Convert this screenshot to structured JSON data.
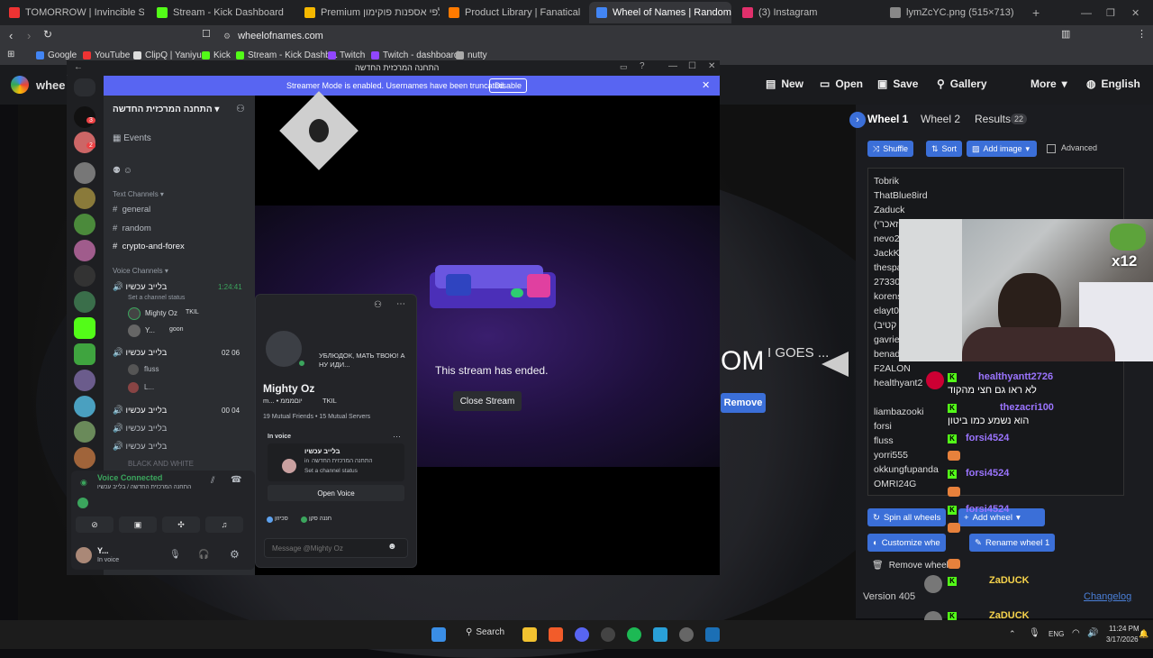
{
  "browser": {
    "tabs": [
      {
        "label": "TOMORROW | Invincible Season 4 O",
        "color": "#e33"
      },
      {
        "label": "Stream - Kick Dashboard",
        "color": "#53fc18"
      },
      {
        "label": "Premium מארז קלפי אספנות פוקימון",
        "color": "#f5b800"
      },
      {
        "label": "Product Library | Fanatical",
        "color": "#ff7a00"
      },
      {
        "label": "Wheel of Names | Random nam",
        "color": "#4285f4"
      },
      {
        "label": "(3) Instagram",
        "color": "#e1306c"
      },
      {
        "label": "lymZcYC.png (515×713)",
        "color": "#888"
      }
    ],
    "url": "wheelofnames.com",
    "bookmarks": [
      "Google",
      "YouTube",
      "ClipQ | Yaniyu",
      "Kick",
      "Stream - Kick Dashb...",
      "Twitch",
      "Twitch - dashboard",
      "nutty"
    ]
  },
  "won": {
    "logo": "whee",
    "menu": [
      "New",
      "Open",
      "Save",
      "Gallery",
      "More",
      "English"
    ],
    "tabs": [
      "Wheel 1",
      "Wheel 2",
      "Results"
    ],
    "results_count": "22",
    "buttons": {
      "shuffle": "Shuffle",
      "sort": "Sort",
      "add_image": "Add image",
      "advanced": "Advanced",
      "spin_all": "Spin all wheels",
      "add_wheel": "Add wheel",
      "customize": "Customize whe",
      "rename": "Rename wheel 1",
      "remove_wheel": "Remove wheel",
      "remove": "Remove"
    },
    "names": [
      "Tobrik",
      "ThatBlue8ird",
      "Zaduck",
      "(זאכרי",
      "nevo2",
      "JackKa",
      "thespa",
      "27330",
      "korens",
      "elayt0",
      "(קטיב",
      "gavrie",
      "benad",
      "F2ALON",
      "healthyant2",
      "liambazooki",
      "forsi",
      "fluss",
      "yorri555",
      "okkungfupanda",
      "OMRI24G"
    ],
    "version": "Version 405",
    "changelog": "Changelog",
    "wheel_text_1": "OM",
    "wheel_text_2": "I GOES ..."
  },
  "chat": [
    {
      "user": "healthyantt2726",
      "msg": "לא ראו גם חצי מהקוד"
    },
    {
      "user": "thezacri100",
      "msg": "הוא נשמע כמו ביטון"
    },
    {
      "user": "forsi4524",
      "msg": ""
    },
    {
      "user": "forsi4524",
      "msg": ""
    },
    {
      "user": "forsi4524",
      "msg": ""
    },
    {
      "user": "ZaDUCK",
      "msg": ""
    },
    {
      "user": "ZaDUCK",
      "msg": ""
    }
  ],
  "webcam_badge": "x12",
  "discord": {
    "title": "התחנה המרכזית החדשה",
    "streamer_notice": "Streamer Mode is enabled. Usernames have been truncated.",
    "disable": "Disable",
    "server_name": "התחנה המרכזית החדשה",
    "events": "Events",
    "text_channels_header": "Text Channels",
    "text_channels": [
      "general",
      "random",
      "crypto-and-forex"
    ],
    "voice_channels_header": "Voice Channels",
    "voice_channels": [
      {
        "name": "בלייב עכשיו",
        "time": "1:24:41"
      },
      {
        "name": "בלייב עכשיו",
        "time": "02 06"
      },
      {
        "name": "בלייב עכשיו",
        "time": "00 04"
      },
      {
        "name": "בלייב עכשיו",
        "time": ""
      },
      {
        "name": "בלייב עכשיו",
        "time": ""
      }
    ],
    "channel_status": "Set a channel status",
    "voice_users": [
      "Mighty Oz",
      "TKIL",
      "Y...",
      "goon",
      "fluss",
      "L..."
    ],
    "black_white": "BLACK AND WHITE",
    "voice_connected": "Voice Connected",
    "voice_sub": "התחנה המרכזית החדשה / בלייב עכשיו",
    "me_name": "Y...",
    "me_status": "In voice",
    "stream_ended": "This stream has ended.",
    "close_stream": "Close Stream",
    "guild_badge_1": "3",
    "guild_badge_2": "2"
  },
  "profile": {
    "status": "УБЛЮДОК, МАТЬ ТВОЮ! А НУ ИДИ...",
    "name": "Mighty Oz",
    "tag": "m... • יוםמממ",
    "tag2": "TKIL",
    "mutual": "19 Mutual Friends • 15 Mutual Servers",
    "in_voice": "In voice",
    "voice_channel": "בלייב עכשיו",
    "voice_in": "in",
    "voice_server": "התחנה המרכזית החדשה",
    "set_status": "Set a channel status",
    "open_voice": "Open Voice",
    "users": [
      "סכיזון",
      "חננה סקן"
    ],
    "message_placeholder": "Message @Mighty Oz"
  },
  "taskbar": {
    "search": "Search",
    "lang": "ENG",
    "time": "11:24 PM",
    "date": "3/17/2026"
  }
}
